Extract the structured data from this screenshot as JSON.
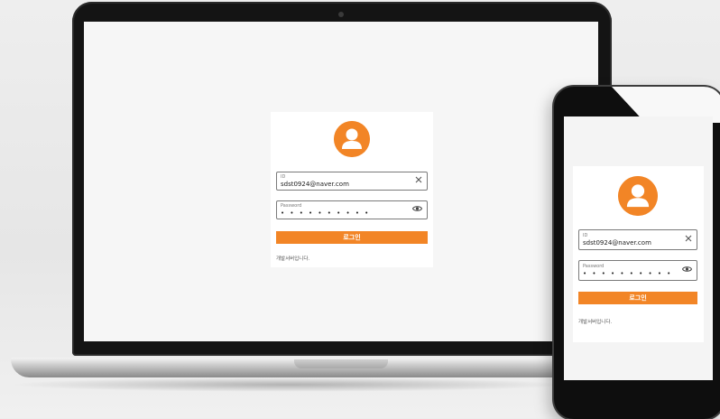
{
  "colors": {
    "accent": "#f28526",
    "field_border": "#7a7a7a"
  },
  "login_form": {
    "avatar_icon": "user-avatar-icon",
    "id_field": {
      "label": "ID",
      "value": "sdst0924@naver.com",
      "clear_icon": "close-icon"
    },
    "password_field": {
      "label": "Password",
      "value": "• • • • • • • • • •",
      "toggle_icon": "eye-icon"
    },
    "login_button": "로그인",
    "footer_text": "개발서버입니다."
  }
}
